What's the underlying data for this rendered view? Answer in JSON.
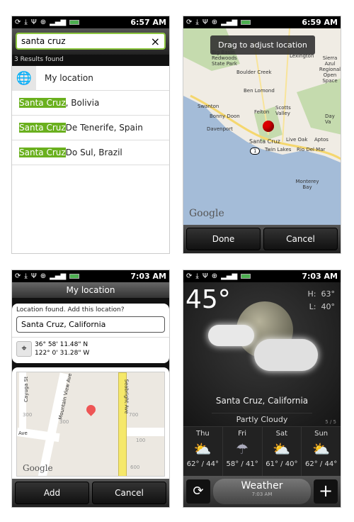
{
  "status_icons": [
    "sync-icon",
    "download-icon",
    "bird-icon",
    "usb-icon",
    "gps-icon",
    "vibrate-icon",
    "ev-icon",
    "signal-icon",
    "battery-icon"
  ],
  "accent": "#6ab01e",
  "screen1": {
    "time": "6:57 AM",
    "search_value": "santa cruz",
    "clear_icon": "×",
    "results_count": "3 Results found",
    "my_location": "My location",
    "results": [
      {
        "match": "Santa Cruz",
        "rest": ", Bolivia"
      },
      {
        "match": "Santa Cruz",
        "rest": " De Tenerife, Spain"
      },
      {
        "match": "Santa Cruz",
        "rest": " Do Sul, Brazil"
      }
    ]
  },
  "screen2": {
    "time": "6:59 AM",
    "toast": "Drag to adjust location",
    "map_labels": [
      "Boulder Creek",
      "Ben Lomond",
      "Swanton",
      "Bonny Doon",
      "Felton",
      "Scotts Valley",
      "Davenport",
      "Santa Cruz",
      "Live Oak",
      "Aptos",
      "Twin Lakes",
      "Rio Del Mar",
      "Monterey Bay",
      "Day Va",
      "Lexington",
      "Sierra Azul Regional Open Space",
      "Big Basin Redwoods State Park",
      "1"
    ],
    "google": "Google",
    "done": "Done",
    "cancel": "Cancel"
  },
  "screen3": {
    "time": "7:03 AM",
    "title": "My location",
    "prompt": "Location found. Add this location?",
    "location_value": "Santa Cruz, California",
    "lat": "36° 58' 11.48\" N",
    "lon": "122° 0' 31.28\" W",
    "map_labels": [
      "Cayuga St",
      "Mountain View Ave",
      "Seabright Ave",
      "Ave",
      "300",
      "300",
      "700",
      "100",
      "600"
    ],
    "google": "Google",
    "add": "Add",
    "cancel": "Cancel"
  },
  "screen4": {
    "time": "7:03 AM",
    "temp": "45°",
    "high_label": "H:",
    "high": "63°",
    "low_label": "L:",
    "low": "40°",
    "city": "Santa Cruz, California",
    "condition": "Partly Cloudy",
    "page": "5 / 5",
    "forecast": [
      {
        "day": "Thu",
        "temps": "62° / 44°",
        "icon": "partly-sunny-icon"
      },
      {
        "day": "Fri",
        "temps": "58° / 41°",
        "icon": "rain-icon"
      },
      {
        "day": "Sat",
        "temps": "61° / 40°",
        "icon": "partly-sunny-icon"
      },
      {
        "day": "Sun",
        "temps": "62° / 44°",
        "icon": "partly-sunny-icon"
      }
    ],
    "app_title": "Weather",
    "updated": "7:03 AM"
  }
}
